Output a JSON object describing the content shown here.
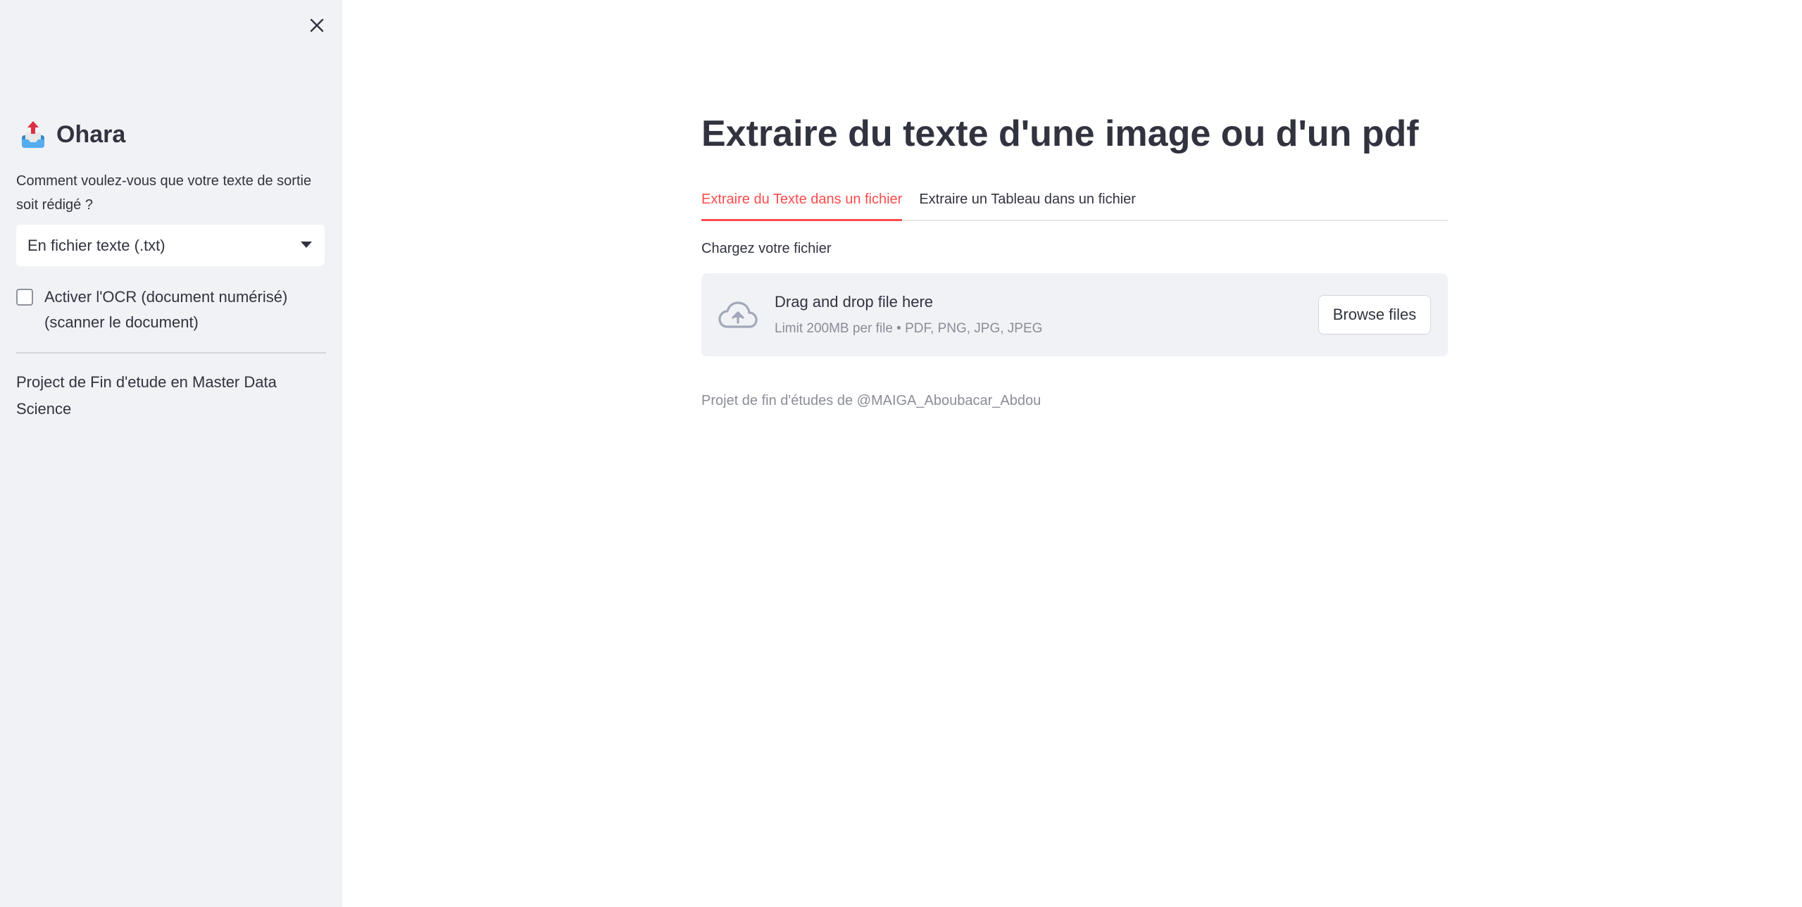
{
  "sidebar": {
    "brand_name": "Ohara",
    "question": "Comment voulez-vous que votre texte de sortie soit rédigé ?",
    "select_value": "En fichier texte (.txt)",
    "checkbox_label": "Activer l'OCR (document numérisé) (scanner le document)",
    "checkbox_checked": false,
    "footer_text": "Project de Fin d'etude en Master Data Science"
  },
  "main": {
    "title": "Extraire du texte d'une image ou d'un pdf",
    "tabs": [
      {
        "label": "Extraire du Texte dans un fichier",
        "active": true
      },
      {
        "label": "Extraire un Tableau dans un fichier",
        "active": false
      }
    ],
    "upload_label": "Chargez votre fichier",
    "dropzone_title": "Drag and drop file here",
    "dropzone_subtitle": "Limit 200MB per file • PDF, PNG, JPG, JPEG",
    "browse_label": "Browse files",
    "credit": "Projet de fin d'études de @MAIGA_Aboubacar_Abdou"
  },
  "colors": {
    "accent": "#ff4b4b",
    "sidebar_bg": "#f0f2f6",
    "text": "#31333f",
    "muted": "#8a8d96"
  },
  "icons": {
    "close": "close-icon",
    "brand": "inbox-tray-icon",
    "dropdown": "chevron-down-icon",
    "upload": "cloud-upload-icon"
  }
}
